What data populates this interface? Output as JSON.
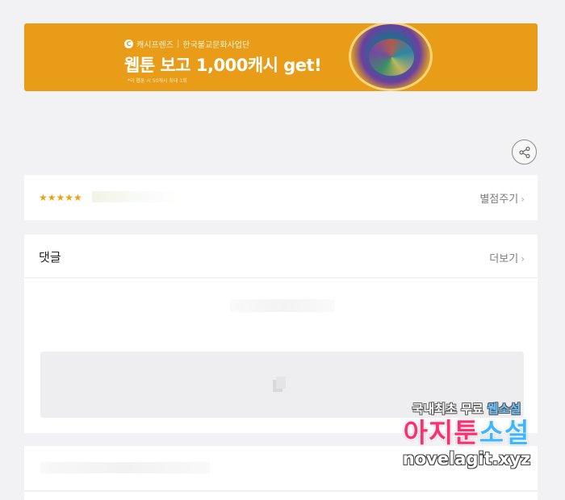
{
  "banner": {
    "brand_logo": "C",
    "brand_name": "캐시프렌즈",
    "separator": "|",
    "partner": "한국불교문화사업단",
    "headline": "웹툰 보고 1,000캐시 get!",
    "fine_print": "*이 웹툰 시 50캐시 최대 1회"
  },
  "share": {
    "icon": "share-icon"
  },
  "rating": {
    "stars": "★★★★★",
    "link_label": "별점주기",
    "chevron": "›"
  },
  "comments": {
    "title": "댓글",
    "more_label": "더보기",
    "chevron": "›",
    "input_icon": "edit-icon"
  },
  "watermark": {
    "line1_a": "국내최초 무료 ",
    "line1_b": "웹소설",
    "line2_a": "아지툰",
    "line2_b": "소설",
    "line3": "novelagit.xyz"
  },
  "colors": {
    "banner_bg": "#e89c17",
    "star": "#e9a315",
    "page_bg": "#f2f2f4"
  }
}
